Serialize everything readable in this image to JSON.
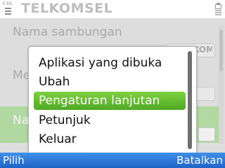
{
  "status": {
    "network_tag": "3.5G",
    "title": "TELKOMSEL"
  },
  "background_form": {
    "connection_name_label": "Nama sambungan",
    "connection_name_value": "TELKOMSEL",
    "second_label": "Me",
    "third_label": "Na"
  },
  "menu": {
    "items": [
      {
        "label": "Aplikasi yang dibuka"
      },
      {
        "label": "Ubah"
      },
      {
        "label": "Pengaturan lanjutan",
        "selected": true
      },
      {
        "label": "Petunjuk"
      },
      {
        "label": "Keluar"
      }
    ]
  },
  "softkeys": {
    "left": "Pilih",
    "right": "Batalkan"
  },
  "colors": {
    "selection_green": "#5cb82d",
    "softkey_blue": "#2a74d8"
  }
}
